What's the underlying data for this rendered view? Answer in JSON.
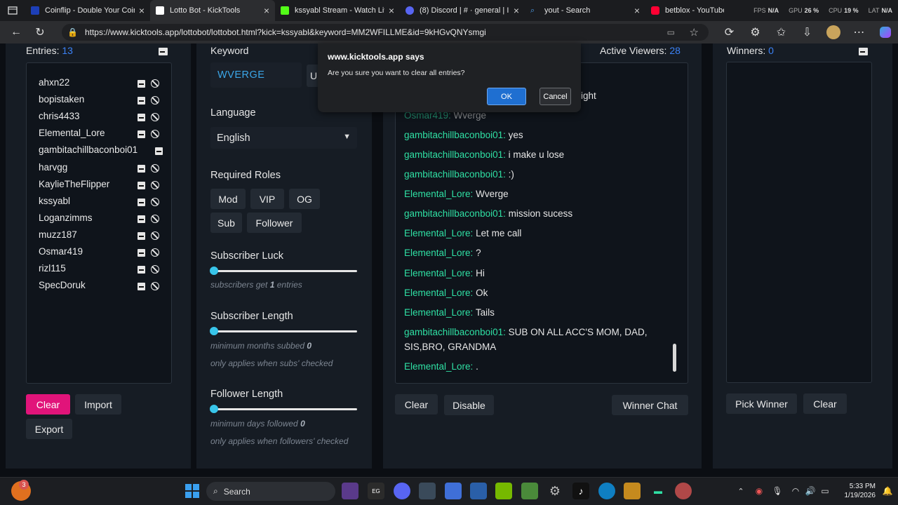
{
  "browser": {
    "tabs": [
      {
        "title": "Coinflip - Double Your Coins",
        "color": "#1d3fb8"
      },
      {
        "title": "Lotto Bot - KickTools",
        "color": "#ffffff"
      },
      {
        "title": "kssyabl Stream - Watch Live",
        "color": "#53fc18"
      },
      {
        "title": "(8) Discord | # · general | I",
        "color": "#5865f2"
      },
      {
        "title": "yout - Search",
        "color": "#4c9eea"
      },
      {
        "title": "betblox - YouTube",
        "color": "#ff0033"
      }
    ],
    "url": "https://www.kicktools.app/lottobot/lottobot.html?kick=kssyabl&keyword=MM2WFILLME&id=9kHGvQNYsmgi",
    "stats": [
      {
        "label": "FPS",
        "value": "N/A"
      },
      {
        "label": "GPU",
        "value": "26 %"
      },
      {
        "label": "CPU",
        "value": "19 %"
      },
      {
        "label": "LAT",
        "value": "N/A"
      }
    ]
  },
  "entries": {
    "heading": "Entries:",
    "count": "13",
    "list": [
      "ahxn22",
      "bopistaken",
      "chris4433",
      "Elemental_Lore",
      "gambitachillbaconboi01",
      "harvgg",
      "KaylieTheFlipper",
      "kssyabl",
      "Loganzimms",
      "muzz187",
      "Osmar419",
      "rizl115",
      "SpecDoruk"
    ],
    "buttons": {
      "clear": "Clear",
      "import": "Import",
      "export": "Export"
    }
  },
  "settings": {
    "keyword_label": "Keyword",
    "keyword_value": "WVERGE",
    "update_partial": "U",
    "language_label": "Language",
    "language_value": "English",
    "roles_label": "Required Roles",
    "roles": [
      "Mod",
      "VIP",
      "OG",
      "Sub",
      "Follower"
    ],
    "sub_luck_label": "Subscriber Luck",
    "sub_luck_pre": "subscribers get",
    "sub_luck_value": "1",
    "sub_luck_post": "entries",
    "sub_length_label": "Subscriber Length",
    "sub_length_pre": "minimum months subbed",
    "sub_length_value": "0",
    "sub_length_note": "only applies when subs' checked",
    "fol_length_label": "Follower Length",
    "fol_length_pre": "minimum days followed",
    "fol_length_value": "0",
    "fol_length_note": "only applies when followers' checked"
  },
  "chat": {
    "viewers_label": "Active Viewers:",
    "viewers_count": "28",
    "partial_top": "ight",
    "messages": [
      {
        "user": "Osmar419:",
        "text": "Wverge"
      },
      {
        "user": "gambitachillbaconboi01:",
        "text": "yes"
      },
      {
        "user": "gambitachillbaconboi01:",
        "text": "i make u lose"
      },
      {
        "user": "gambitachillbaconboi01:",
        "text": ":)"
      },
      {
        "user": "Elemental_Lore:",
        "text": "Wverge"
      },
      {
        "user": "gambitachillbaconboi01:",
        "text": "mission sucess"
      },
      {
        "user": "Elemental_Lore:",
        "text": "Let me call"
      },
      {
        "user": "Elemental_Lore:",
        "text": "?"
      },
      {
        "user": "Elemental_Lore:",
        "text": "Hi"
      },
      {
        "user": "Elemental_Lore:",
        "text": "Ok"
      },
      {
        "user": "Elemental_Lore:",
        "text": "Tails"
      },
      {
        "user": "gambitachillbaconboi01:",
        "text": "SUB ON ALL ACC'S MOM, DAD, SIS,BRO, GRANDMA"
      },
      {
        "user": "Elemental_Lore:",
        "text": "."
      }
    ],
    "buttons": {
      "clear": "Clear",
      "disable": "Disable",
      "winner_chat": "Winner Chat"
    }
  },
  "winners": {
    "heading": "Winners:",
    "count": "0",
    "buttons": {
      "pick": "Pick Winner",
      "clear": "Clear"
    }
  },
  "dialog": {
    "title": "www.kicktools.app says",
    "message": "Are you sure you want to clear all entries?",
    "ok": "OK",
    "cancel": "Cancel"
  },
  "taskbar": {
    "search": "Search",
    "time": "5:33 PM",
    "date": "1/19/2026",
    "notification_badge": "3"
  }
}
